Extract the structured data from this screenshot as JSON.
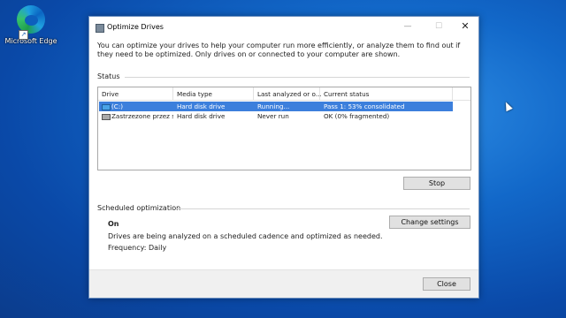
{
  "desktop": {
    "icons": [
      {
        "label": "Microsoft Edge",
        "icon": "edge-icon"
      }
    ]
  },
  "window": {
    "title": "Optimize Drives",
    "intro": "You can optimize your drives to help your computer run more efficiently, or analyze them to find out if they need to be optimized. Only drives on or connected to your computer are shown.",
    "status_label": "Status",
    "columns": [
      "Drive",
      "Media type",
      "Last analyzed or o...",
      "Current status"
    ],
    "drives": [
      {
        "drive": "(C:)",
        "media": "Hard disk drive",
        "last": "Running...",
        "status": "Pass 1: 53% consolidated",
        "selected": true,
        "icon": "system-drive-icon"
      },
      {
        "drive": "Zastrzezone przez s...",
        "media": "Hard disk drive",
        "last": "Never run",
        "status": "OK (0% fragmented)",
        "selected": false,
        "icon": "drive-icon"
      }
    ],
    "stop_label": "Stop",
    "scheduled": {
      "label": "Scheduled optimization",
      "state": "On",
      "description": "Drives are being analyzed on a scheduled cadence and optimized as needed.",
      "frequency": "Frequency: Daily",
      "change_label": "Change settings"
    },
    "close_label": "Close"
  },
  "colors": {
    "selection": "#3c7fdc",
    "desktop": "#1268c9"
  }
}
